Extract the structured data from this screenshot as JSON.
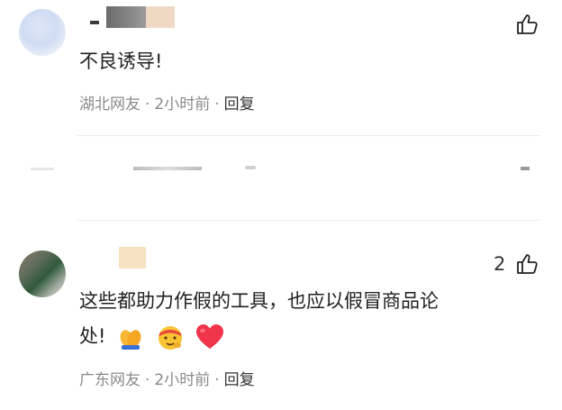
{
  "comments": [
    {
      "text": "不良诱导!",
      "region": "湖北网友",
      "time": "2小时前",
      "reply_label": "回复",
      "like_count": ""
    },
    {
      "text_line1": "这些都助力作假的工具，也应以假冒商品论",
      "text_line2": "处!",
      "region": "广东网友",
      "time": "2小时前",
      "reply_label": "回复",
      "like_count": "2",
      "emojis": [
        "folded-hands-emoji",
        "face-with-headband-emoji",
        "red-heart-emoji"
      ]
    }
  ],
  "separator": "·",
  "icons": {
    "like": "thumbs-up-outline-icon"
  },
  "colors": {
    "meta": "#8a8a8a",
    "divider": "#ececec",
    "heart": "#f0344a"
  }
}
